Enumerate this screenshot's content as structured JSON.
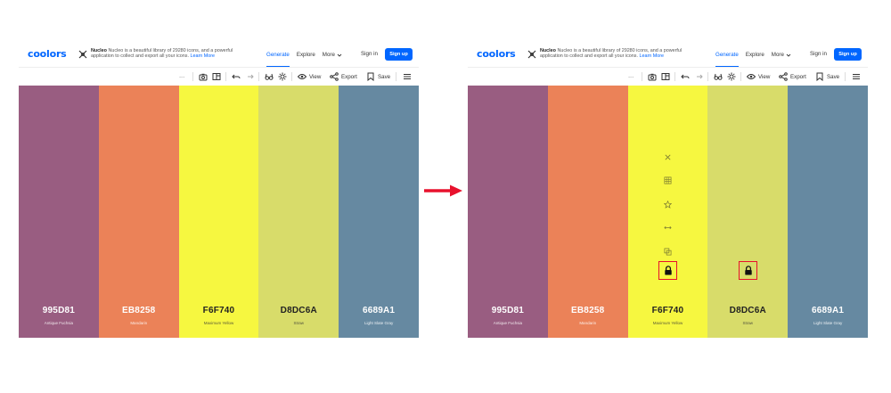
{
  "navbar": {
    "logo": "coolors",
    "ad": {
      "brand": "Nucleo",
      "text_line1": " Nucleo is a beautiful library of 29280 icons, and a powerful",
      "text_line2": "application to collect and export all your icons. ",
      "link": "Learn More"
    },
    "links": {
      "generate": "Generate",
      "explore": "Explore",
      "more": "More"
    },
    "signin": "Sign in",
    "signup": "Sign up"
  },
  "toolbar": {
    "ellipsis": "···",
    "view_label": "View",
    "export_label": "Export",
    "save_label": "Save"
  },
  "palette": [
    {
      "hex": "995D81",
      "name": "Antique Fuchsia",
      "color": "#995D81"
    },
    {
      "hex": "EB8258",
      "name": "Mandarin",
      "color": "#EB8258"
    },
    {
      "hex": "F6F740",
      "name": "Maximum Yellow",
      "color": "#F6F740"
    },
    {
      "hex": "D8DC6A",
      "name": "Straw",
      "color": "#D8DC6A"
    },
    {
      "hex": "6689A1",
      "name": "Light Slate Gray",
      "color": "#6689A1"
    }
  ],
  "colors": {
    "accent": "#0066ff",
    "highlight": "#e8112d",
    "arrow": "#e8112d"
  },
  "icons": [
    "x-icon",
    "grid-icon",
    "star-icon",
    "arrows-icon",
    "copy-icon",
    "lock-icon"
  ]
}
